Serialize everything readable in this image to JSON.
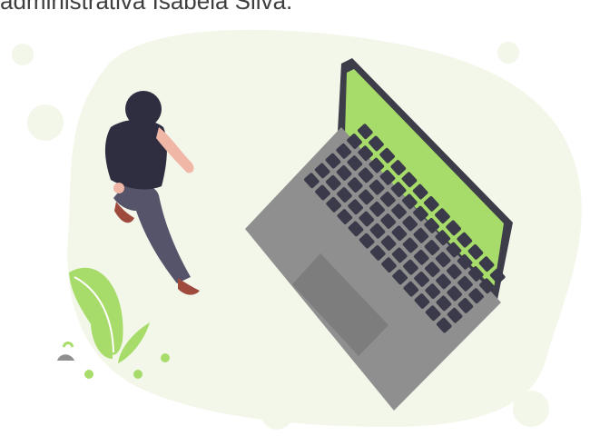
{
  "caption": {
    "text": "administrativa Isabela Silva."
  },
  "illustration": {
    "subjects": [
      "person-walking",
      "laptop",
      "plant"
    ],
    "colors": {
      "blob": "#f3f7ea",
      "screen": "#a8dc6a",
      "laptop_body": "#8f8f8f",
      "laptop_frame": "#3d3d4a",
      "keys": "#3a3a4a",
      "trackpad": "#7d7d7d",
      "shirt": "#2f2e41",
      "pants": "#55546a",
      "skin": "#f0b6a6",
      "hair": "#2f2e41",
      "shoes": "#9e4b3e",
      "leaf": "#a8dc6a",
      "leaf_vein": "#ffffff"
    }
  }
}
